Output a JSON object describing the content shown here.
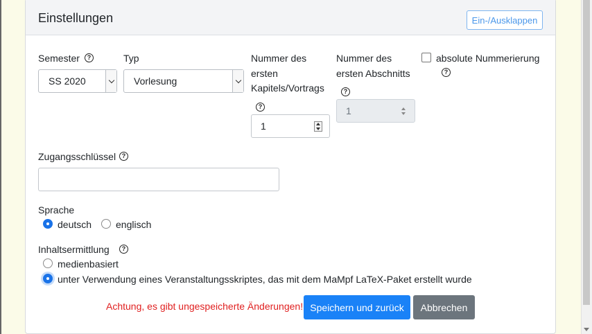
{
  "card": {
    "title": "Einstellungen",
    "toggle_label": "Ein-/Ausklappen"
  },
  "semester": {
    "label": "Semester",
    "value": "SS 2020"
  },
  "typ": {
    "label": "Typ",
    "value": "Vorlesung"
  },
  "chapter_start": {
    "label_line1": "Nummer des",
    "label_line2": "ersten",
    "label_line3": "Kapitels/Vortrags",
    "value": "1"
  },
  "section_start": {
    "label_line1": "Nummer des",
    "label_line2": "ersten Abschnitts",
    "value": "1"
  },
  "absolute_numbering": {
    "label": "absolute Nummerierung",
    "checked": false
  },
  "access_key": {
    "label": "Zugangsschlüssel",
    "value": ""
  },
  "language": {
    "label": "Sprache",
    "options": [
      "deutsch",
      "englisch"
    ],
    "selected": "deutsch"
  },
  "content_detection": {
    "label": "Inhaltsermittlung",
    "options": [
      "medienbasiert",
      "unter Verwendung eines Veranstaltungsskriptes, das mit dem MaMpf LaTeX-Paket erstellt wurde"
    ],
    "selected": "unter Verwendung eines Veranstaltungsskriptes, das mit dem MaMpf LaTeX-Paket erstellt wurde"
  },
  "footer": {
    "warning": "Achtung, es gibt ungespeicherte Änderungen!",
    "save_label": "Speichern und zurück",
    "cancel_label": "Abbrechen"
  },
  "help_glyph": "?",
  "colors": {
    "primary": "#1a82f7",
    "secondary": "#6c757d",
    "warning": "#e02020",
    "background": "#fbfbe8"
  }
}
